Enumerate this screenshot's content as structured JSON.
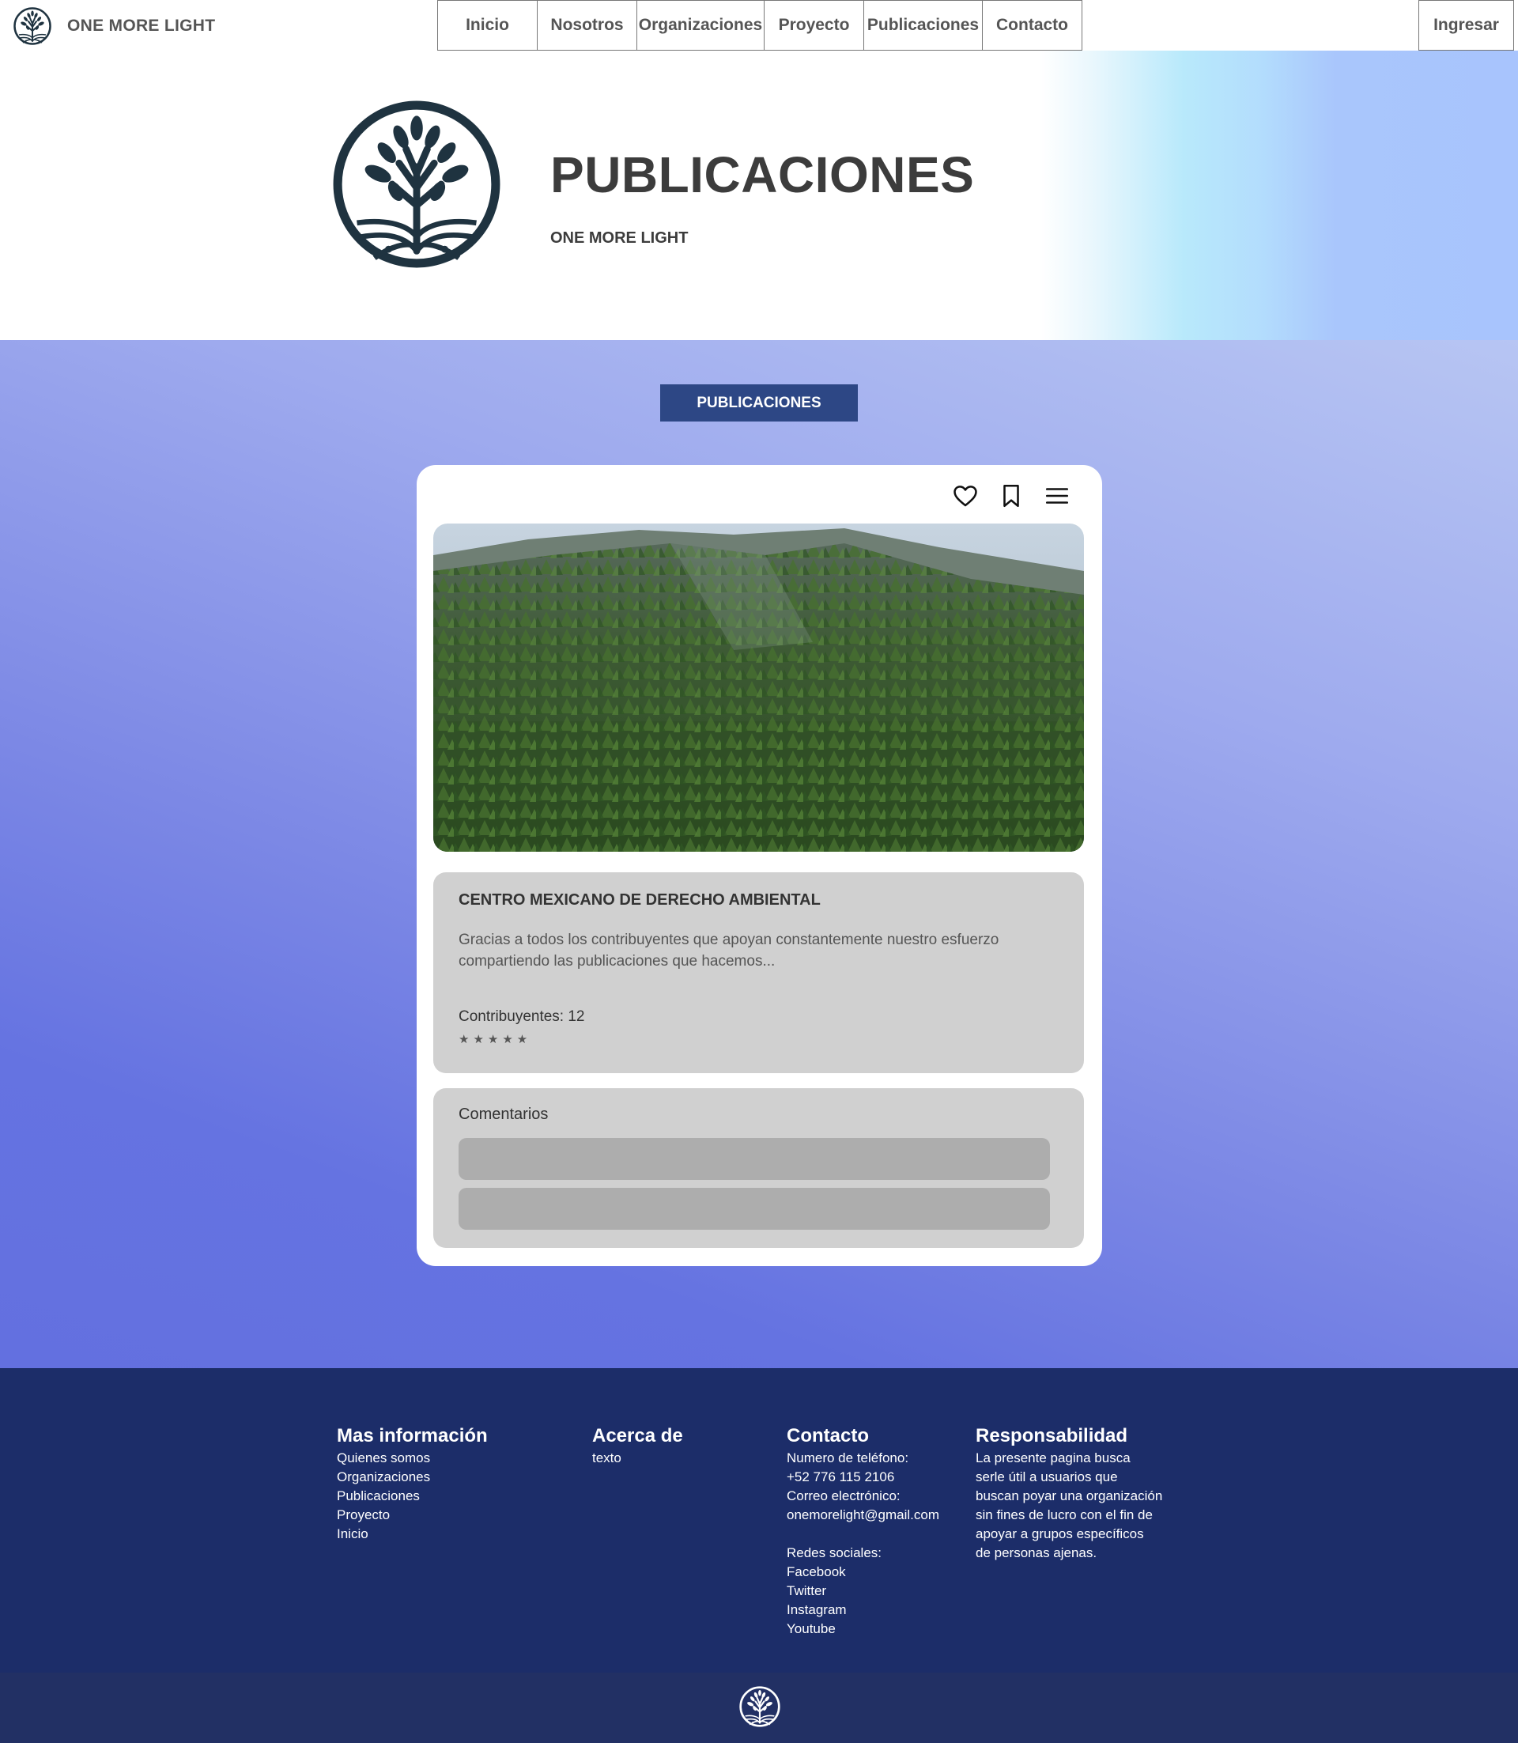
{
  "brand": {
    "name": "ONE MORE LIGHT",
    "logo_icon": "tree-of-life-icon"
  },
  "nav": {
    "items": [
      {
        "label": "Inicio"
      },
      {
        "label": "Nosotros"
      },
      {
        "label": "Organizaciones"
      },
      {
        "label": "Proyecto"
      },
      {
        "label": "Publicaciones"
      },
      {
        "label": "Contacto"
      }
    ],
    "login_label": "Ingresar"
  },
  "hero": {
    "title": "PUBLICACIONES",
    "subtitle": "ONE MORE LIGHT"
  },
  "section": {
    "button_label": "PUBLICACIONES"
  },
  "post": {
    "icons": [
      "heart-icon",
      "bookmark-icon",
      "menu-icon"
    ],
    "image": "forest-photo",
    "title": "CENTRO MEXICANO DE DERECHO AMBIENTAL",
    "description": "Gracias a todos los contribuyentes que apoyan constantemente nuestro esfuerzo compartiendo las publicaciones que hacemos...",
    "contributors": "Contribuyentes: 12",
    "rating_stars": "★★★★★",
    "comments_title": "Comentarios"
  },
  "footer": {
    "mas_info": {
      "title": "Mas información",
      "links": [
        "Quienes somos",
        "Organizaciones",
        "Publicaciones",
        "Proyecto",
        "Inicio"
      ]
    },
    "acerca": {
      "title": "Acerca de",
      "text": "texto"
    },
    "contacto": {
      "title": "Contacto",
      "phone_label": "Numero de teléfono:",
      "phone": "+52 776 115 2106",
      "email_label": "Correo electrónico:",
      "email": "onemorelight@gmail.com",
      "social_label": "Redes sociales:",
      "social": [
        "Facebook",
        "Twitter",
        "Instagram",
        "Youtube"
      ]
    },
    "responsabilidad": {
      "title": "Responsabilidad",
      "lines": [
        "La presente pagina busca",
        "serle útil a usuarios que",
        "buscan poyar una organización",
        "sin fines de lucro con el fin de",
        "apoyar a grupos específicos",
        "de personas ajenas."
      ]
    }
  },
  "colors": {
    "nav_pill": "#2d4785",
    "footer_bg": "#1c2d69",
    "logo_dark": "#1f3340",
    "card_panel": "#d0d0d0"
  }
}
